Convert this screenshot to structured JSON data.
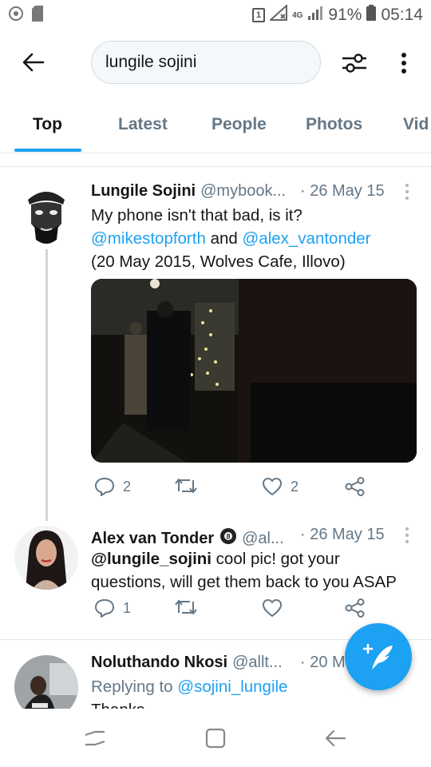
{
  "status_bar": {
    "sim_label": "1",
    "network_type": "4G",
    "battery_percent": "91%",
    "time": "05:14"
  },
  "search": {
    "query": "lungile sojini"
  },
  "tabs": [
    {
      "label": "Top",
      "active": true
    },
    {
      "label": "Latest",
      "active": false
    },
    {
      "label": "People",
      "active": false
    },
    {
      "label": "Photos",
      "active": false
    },
    {
      "label": "Vid",
      "active": false
    }
  ],
  "tweets": [
    {
      "name": "Lungile Sojini",
      "handle": "@mybook...",
      "date": "· 26 May 15",
      "text_line1": "My phone isn't that bad, is it?",
      "mention1": "@mikestopforth",
      "and_text": " and ",
      "mention2": "@alex_vantonder",
      "text_line3": "(20 May 2015, Wolves Cafe, Illovo)",
      "replies": "2",
      "likes": "2"
    },
    {
      "name": "Alex van Tonder",
      "handle": "@al...",
      "date": "· 26 May 15",
      "mention": "@lungile_sojini",
      "text": " cool pic! got your questions, will get them back to you ASAP",
      "replies": "1",
      "likes": ""
    },
    {
      "name": "Noluthando Nkosi",
      "handle": "@allt...",
      "date": "· 20 M",
      "replying_prefix": "Replying to ",
      "replying_to": "@sojini_lungile",
      "text_partial": "Thanks..."
    }
  ],
  "colors": {
    "accent": "#1da1f2",
    "secondary_text": "#657786",
    "divider": "#e1e8ed"
  }
}
